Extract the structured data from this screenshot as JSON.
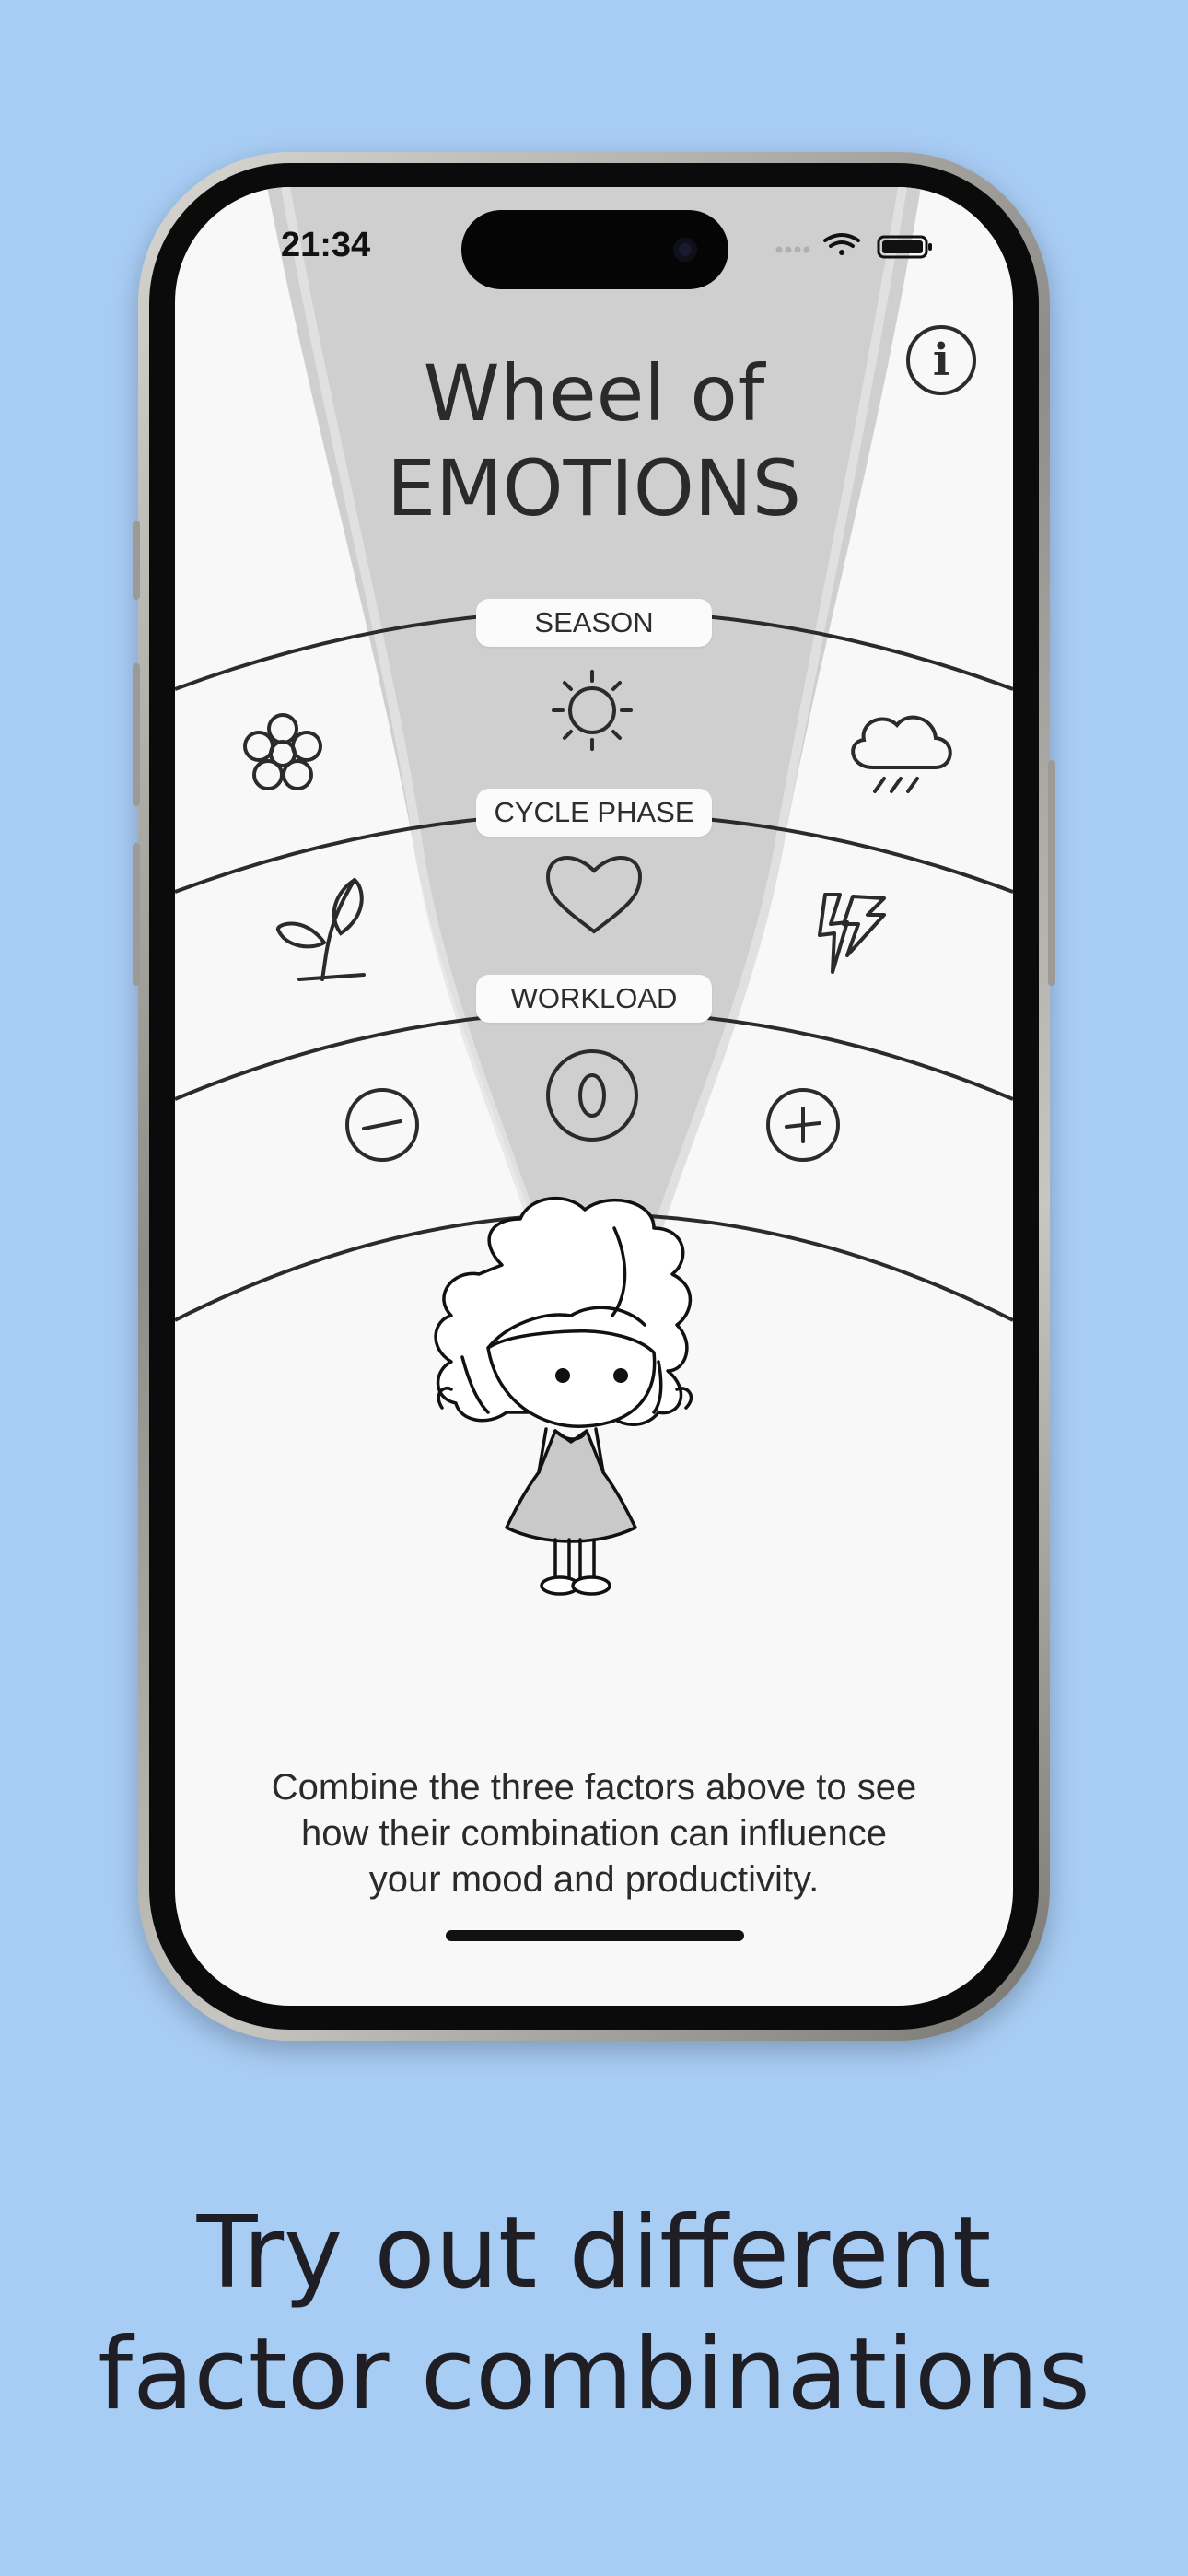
{
  "status_bar": {
    "time": "21:34"
  },
  "app": {
    "title_line1": "Wheel of",
    "title_line2": "EMOTIONS",
    "info_icon": "info-icon",
    "rings": [
      {
        "label": "SEASON",
        "icons": [
          "flower-icon",
          "sun-icon",
          "rain-cloud-icon"
        ]
      },
      {
        "label": "CYCLE PHASE",
        "icons": [
          "sprout-icon",
          "heart-icon",
          "lightning-icon"
        ]
      },
      {
        "label": "WORKLOAD",
        "icons": [
          "minus-icon",
          "zero-icon",
          "plus-icon"
        ],
        "center_symbol": "0"
      }
    ],
    "caption_line1": "Combine the three factors above to see",
    "caption_line2": "how their combination can influence",
    "caption_line3": "your mood and productivity."
  },
  "marketing": {
    "tagline_line1": "Try out different",
    "tagline_line2": "factor combinations"
  },
  "colors": {
    "background": "#a8cdf5",
    "screen": "#f8f8f8",
    "beam": "#cfcfcf",
    "ink": "#2a2a2a"
  }
}
